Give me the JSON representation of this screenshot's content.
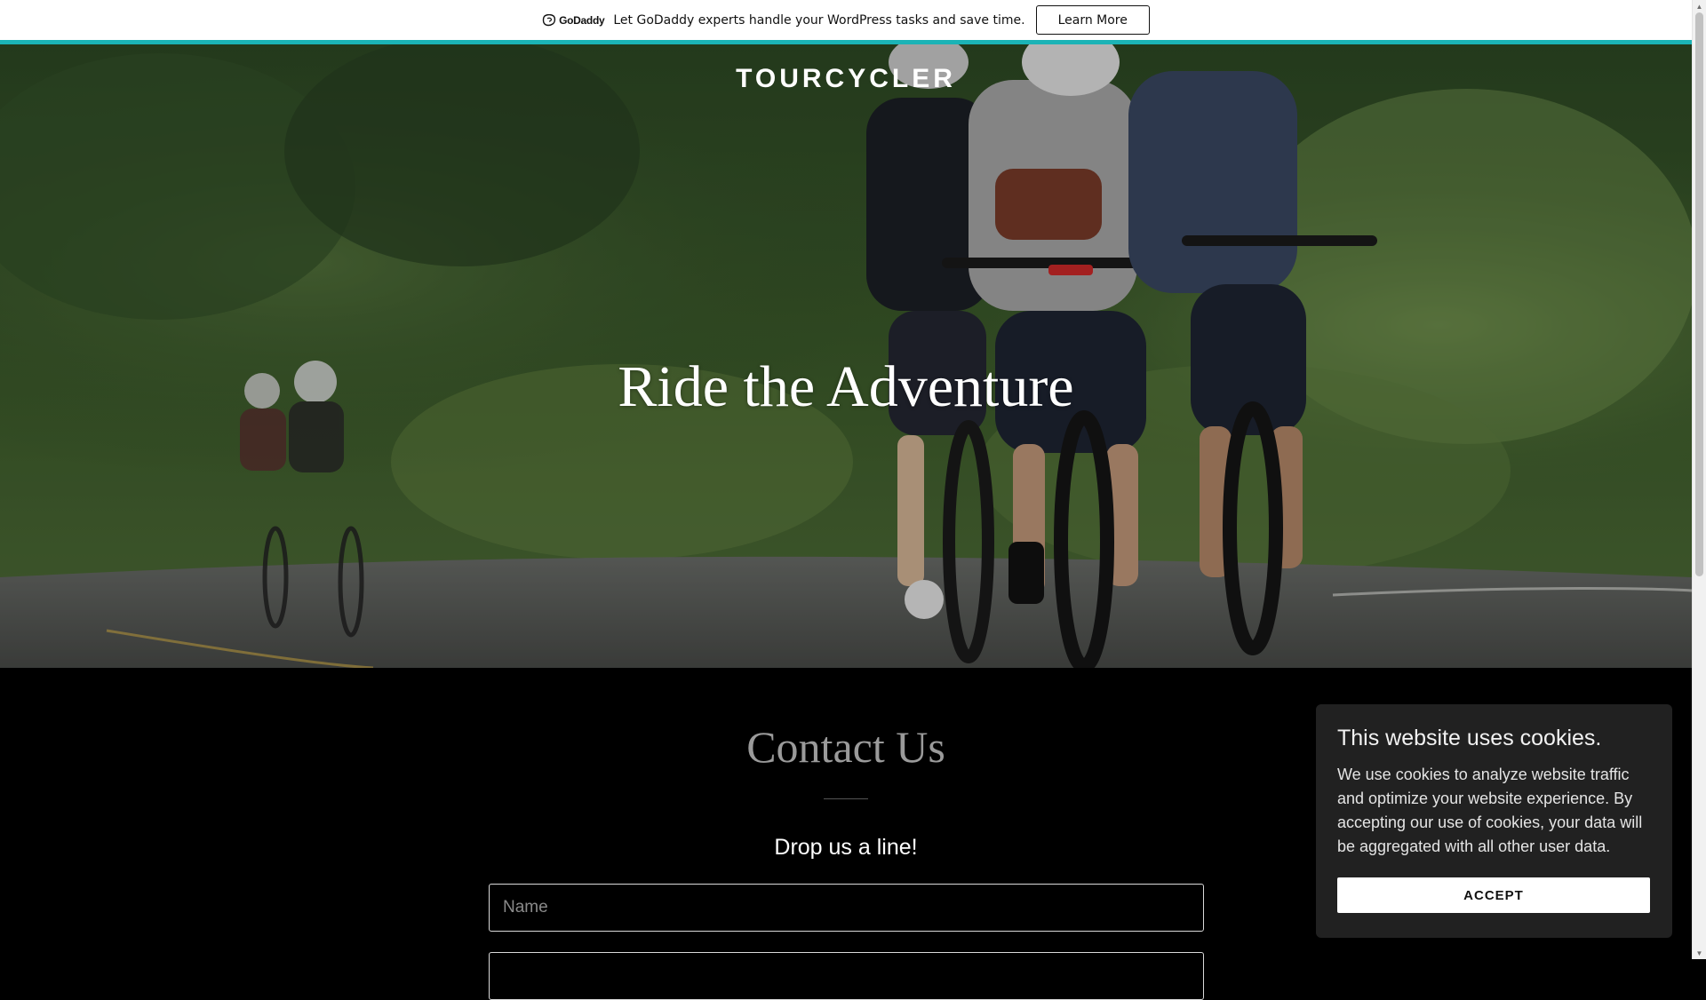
{
  "promo": {
    "logo_text": "GoDaddy",
    "message": "Let GoDaddy experts handle your WordPress tasks and save time.",
    "button_label": "Learn More",
    "accent_color": "#1bb3b6"
  },
  "header": {
    "brand": "TOURCYCLER"
  },
  "hero": {
    "title": "Ride the Adventure",
    "image_description_icon": "cyclists-photo"
  },
  "contact": {
    "title": "Contact Us",
    "subtitle": "Drop us a line!",
    "name_placeholder": "Name",
    "email_placeholder": ""
  },
  "cookie_banner": {
    "title": "This website uses cookies.",
    "body": "We use cookies to analyze website traffic and optimize your website experience. By accepting our use of cookies, your data will be aggregated with all other user data.",
    "accept_label": "ACCEPT"
  },
  "scrollbar": {
    "up_icon": "chevron-up-icon",
    "down_icon": "chevron-down-icon"
  }
}
